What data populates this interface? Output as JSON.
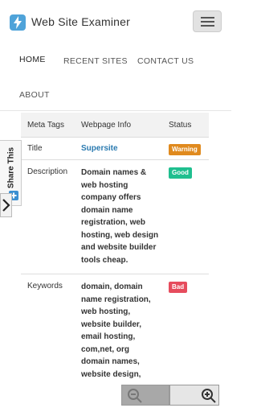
{
  "header": {
    "app_title": "Web Site Examiner",
    "logo_icon": "lightning-bolt-icon",
    "menu_icon": "hamburger-menu-icon"
  },
  "nav": {
    "items": [
      "HOME",
      "RECENT SITES",
      "CONTACT US",
      "ABOUT"
    ],
    "active": "HOME"
  },
  "table": {
    "headers": [
      "Meta Tags",
      "Webpage Info",
      "Status"
    ],
    "rows": [
      {
        "tag": "Title",
        "info": "Supersite",
        "status": "Warning"
      },
      {
        "tag": "Description",
        "info_lines": [
          "Domain names &",
          "web hosting",
          "company offers",
          "domain name",
          "registration, web",
          "hosting, web design",
          "and website builder",
          "tools cheap."
        ],
        "status": "Good"
      },
      {
        "tag": "Keywords",
        "info_lines": [
          "domain, domain",
          "name registration,",
          "web hosting,",
          "website builder,",
          "email hosting,",
          "com,net, org",
          "domain names,",
          "website design,"
        ],
        "status": "Bad"
      }
    ]
  },
  "share": {
    "label": "Share This",
    "plus_icon": "plus-icon",
    "collapse_icon": "chevron-right-icon"
  },
  "zoom": {
    "out_icon": "zoom-out-icon",
    "in_icon": "zoom-in-icon"
  },
  "colors": {
    "warning": "#e08a1e",
    "good": "#1fbf8f",
    "bad": "#e64c5d",
    "link": "#2a7ab0"
  }
}
